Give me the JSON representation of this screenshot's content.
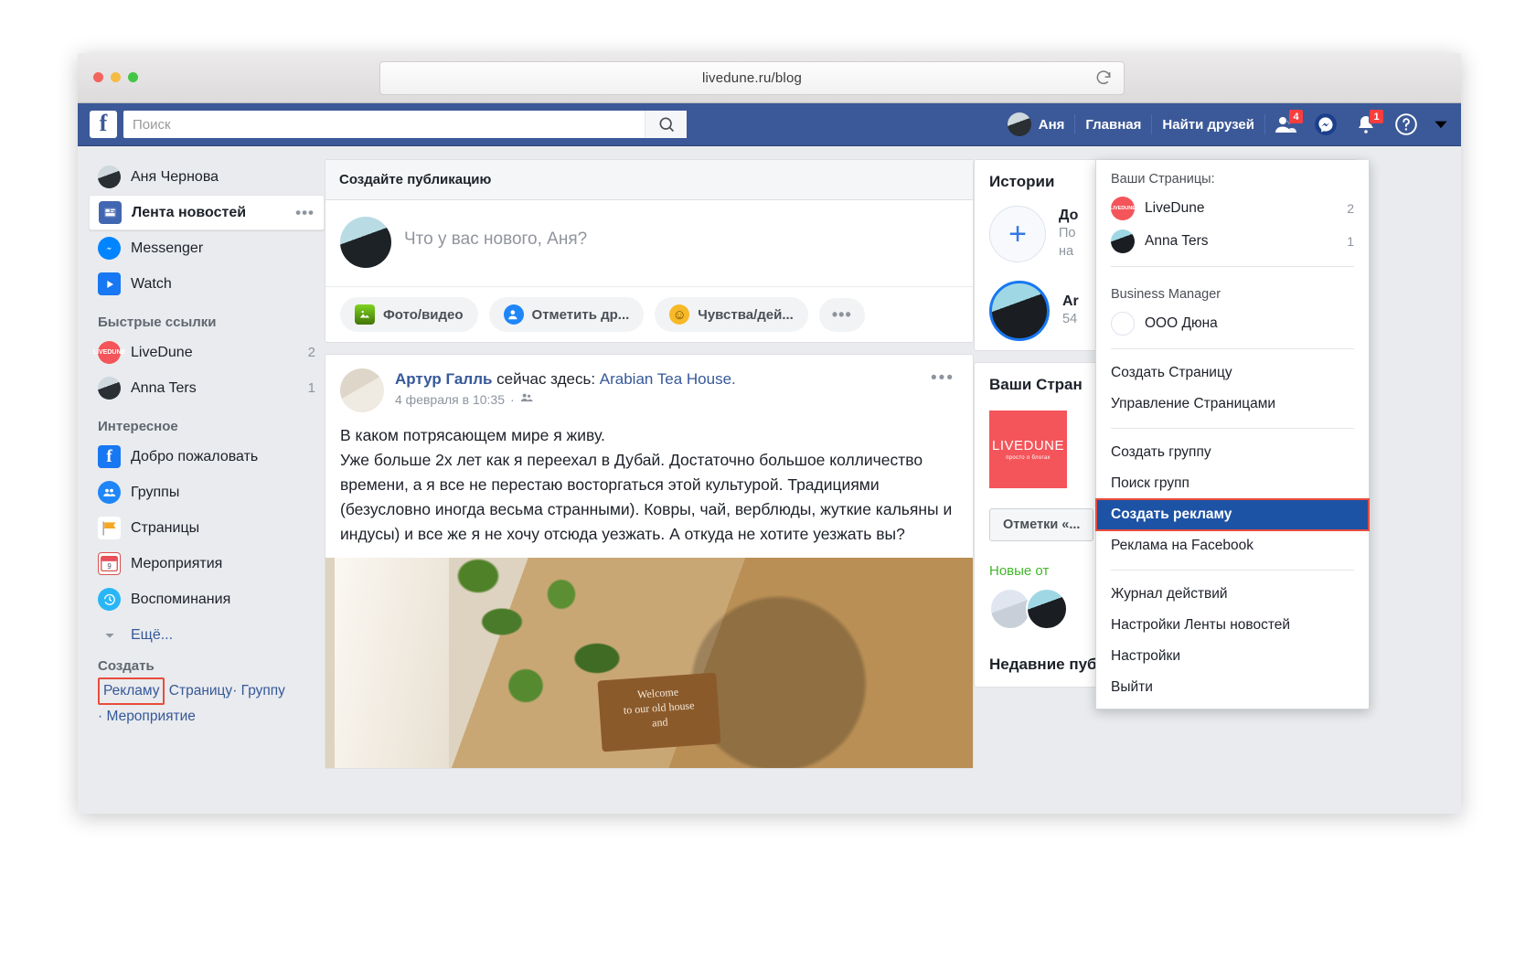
{
  "browser": {
    "url": "livedune.ru/blog",
    "reload_icon": "reload-icon"
  },
  "topbar": {
    "logo": "f",
    "search_placeholder": "Поиск",
    "search_value": "",
    "profile_name": "Аня",
    "home": "Главная",
    "find_friends": "Найти друзей",
    "friend_requests_badge": "4",
    "notifications_badge": "1"
  },
  "sidebar": {
    "user": "Аня Чернова",
    "main_items": [
      {
        "label": "Лента новостей",
        "icon": "news-feed-icon",
        "dots": "•••"
      },
      {
        "label": "Messenger",
        "icon": "messenger-icon"
      },
      {
        "label": "Watch",
        "icon": "watch-icon"
      }
    ],
    "quick_links_heading": "Быстрые ссылки",
    "quick_links": [
      {
        "label": "LiveDune",
        "count": "2",
        "icon": "livedune-icon"
      },
      {
        "label": "Anna Ters",
        "count": "1",
        "icon": "avatar-icon"
      }
    ],
    "interesting_heading": "Интересное",
    "interesting": [
      {
        "label": "Добро пожаловать",
        "icon": "facebook-icon"
      },
      {
        "label": "Группы",
        "icon": "groups-icon"
      },
      {
        "label": "Страницы",
        "icon": "pages-flag-icon"
      },
      {
        "label": "Мероприятия",
        "icon": "calendar-icon"
      },
      {
        "label": "Воспоминания",
        "icon": "memories-clock-icon"
      },
      {
        "label": "Ещё...",
        "icon": "chevron-down-icon"
      }
    ],
    "create_heading": "Создать",
    "create_links": {
      "ad": "Рекламу",
      "page": "Страницу",
      "group": "Группу",
      "event": "Мероприятие",
      "sep": "·"
    }
  },
  "composer": {
    "card_title": "Создайте публикацию",
    "placeholder": "Что у вас нового, Аня?",
    "actions": [
      {
        "label": "Фото/видео",
        "icon": "photo-video-icon"
      },
      {
        "label": "Отметить др...",
        "icon": "tag-friend-icon"
      },
      {
        "label": "Чувства/дей...",
        "icon": "feeling-icon"
      }
    ],
    "more": "•••"
  },
  "post": {
    "author": "Артур Галль",
    "action": " сейчас здесь: ",
    "place": "Arabian Tea House.",
    "date": "4 февраля в 10:35",
    "sep": "·",
    "audience_icon": "friends-icon",
    "menu": "•••",
    "text": "В каком потрясающем мире я живу.\nУже больше 2х лет как я переехал в Дубай. Достаточно большое колличество времени, а я все не перестаю восторгаться этой культурой. Традициями (безусловно иногда весьма странными). Ковры, чай, верблюды, жуткие кальяны и индусы) и все же я не хочу отсюда уезжать. А откуда не хотите уезжать вы?",
    "image_sign": "Welcome\nto our old house\nand"
  },
  "right": {
    "stories_title": "Истории",
    "story_add": {
      "title": "До",
      "subtitle": "По\nна"
    },
    "story_user": {
      "title": "Ar",
      "subtitle": "54"
    },
    "pages_title": "Ваши Стран",
    "page_thumb": {
      "line1": "LIVEDUNE",
      "line2": "просто о блогах"
    },
    "marks_button": "Отметки «...",
    "green_link": "Новые от",
    "recent_title": "Недавние публикации"
  },
  "dropdown": {
    "pages_heading": "Ваши Страницы:",
    "pages": [
      {
        "label": "LiveDune",
        "count": "2",
        "icon": "livedune-icon"
      },
      {
        "label": "Anna Ters",
        "count": "1",
        "icon": "avatar-icon"
      }
    ],
    "bm_heading": "Business Manager",
    "bm_item": {
      "label": "ООО Дюна",
      "icon": "business-icon"
    },
    "items_group1": [
      "Создать Страницу",
      "Управление Страницами"
    ],
    "items_group2": [
      "Создать группу",
      "Поиск групп"
    ],
    "selected_item": "Создать рекламу",
    "items_group3": [
      "Реклама на Facebook"
    ],
    "items_group4": [
      "Журнал действий",
      "Настройки Ленты новостей",
      "Настройки",
      "Выйти"
    ]
  },
  "colors": {
    "fb_blue": "#3b5998",
    "selected_blue": "#1d53a5",
    "highlight_red": "#e74c3c",
    "link_blue": "#365899",
    "green": "#42b72a"
  }
}
